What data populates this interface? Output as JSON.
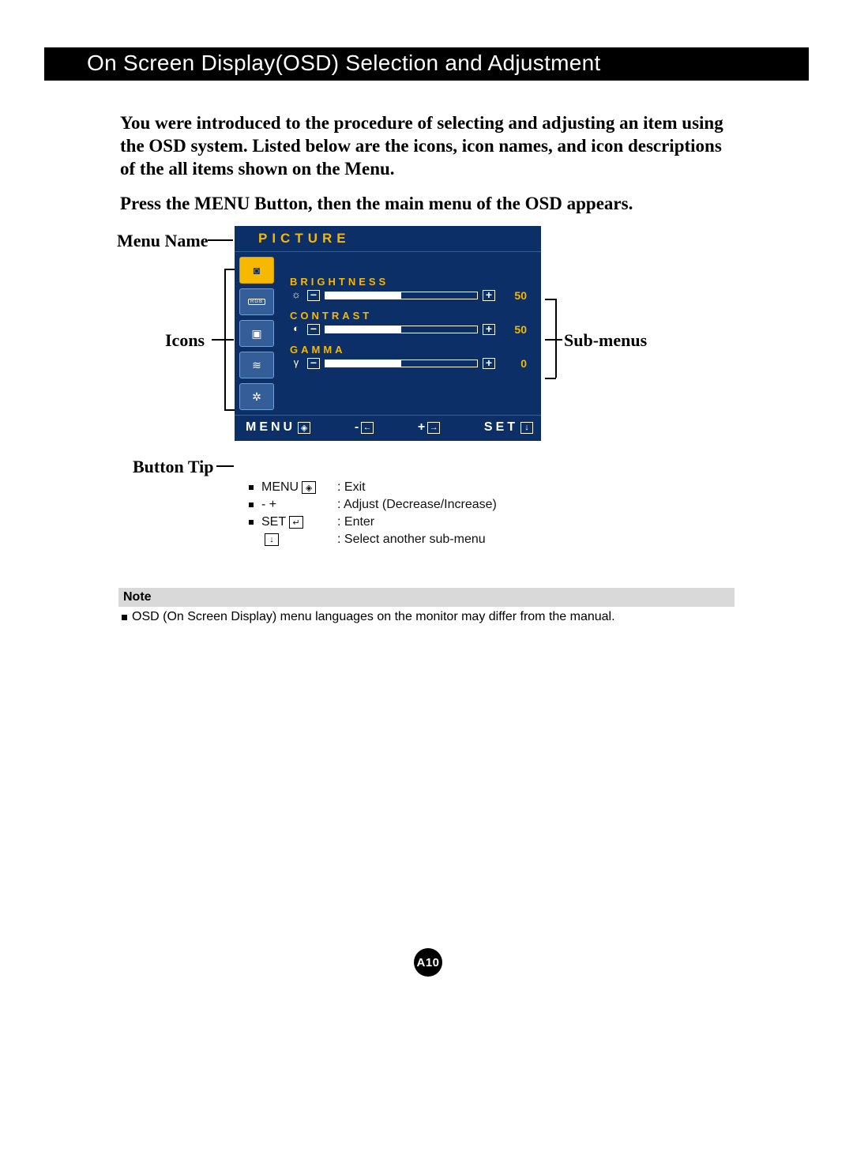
{
  "header": {
    "title": "On Screen Display(OSD) Selection and Adjustment"
  },
  "intro1": "You were introduced to the procedure of selecting and adjusting an item using the OSD system.  Listed below are the icons, icon names, and icon descriptions of the all items shown on the Menu.",
  "intro2": "Press the MENU Button, then the main menu of the OSD appears.",
  "annotations": {
    "menu_name": "Menu Name",
    "icons": "Icons",
    "button_tip": "Button Tip",
    "sub_menus": "Sub-menus"
  },
  "osd": {
    "title": "PICTURE",
    "side_icons": [
      {
        "name": "picture-icon",
        "glyph": "◙",
        "selected": true
      },
      {
        "name": "color-icon",
        "glyph": "RGB",
        "selected": false
      },
      {
        "name": "tracking-icon",
        "glyph": "▣",
        "selected": false
      },
      {
        "name": "setup-icon",
        "glyph": "≋",
        "selected": false
      },
      {
        "name": "other-icon",
        "glyph": "✲",
        "selected": false
      }
    ],
    "rows": [
      {
        "label": "BRIGHTNESS",
        "icon": "☼",
        "value": 50,
        "value_text": "50",
        "fill_pct": 50
      },
      {
        "label": "CONTRAST",
        "icon": "◐",
        "value": 50,
        "value_text": "50",
        "fill_pct": 50
      },
      {
        "label": "GAMMA",
        "icon": "γ",
        "value": 0,
        "value_text": "0",
        "fill_pct": 50
      }
    ],
    "footer": {
      "menu_label": "MENU",
      "menu_glyph": "◈",
      "minus_label": "-",
      "minus_glyph": "←",
      "plus_label": "+",
      "plus_glyph": "→",
      "set_label": "SET",
      "set_glyph": "↓"
    }
  },
  "tips": [
    {
      "lead": "MENU",
      "glyph": "◈",
      "desc": ": Exit"
    },
    {
      "lead": "-   +",
      "glyph": "",
      "desc": ": Adjust (Decrease/Increase)"
    },
    {
      "lead": "SET",
      "glyph": "↵",
      "desc": ": Enter"
    },
    {
      "lead": "",
      "glyph": "↓",
      "desc": ": Select another sub-menu"
    }
  ],
  "note": {
    "head": "Note",
    "body": "OSD (On Screen Display) menu languages on the monitor may differ from the manual."
  },
  "page_number": "A10"
}
